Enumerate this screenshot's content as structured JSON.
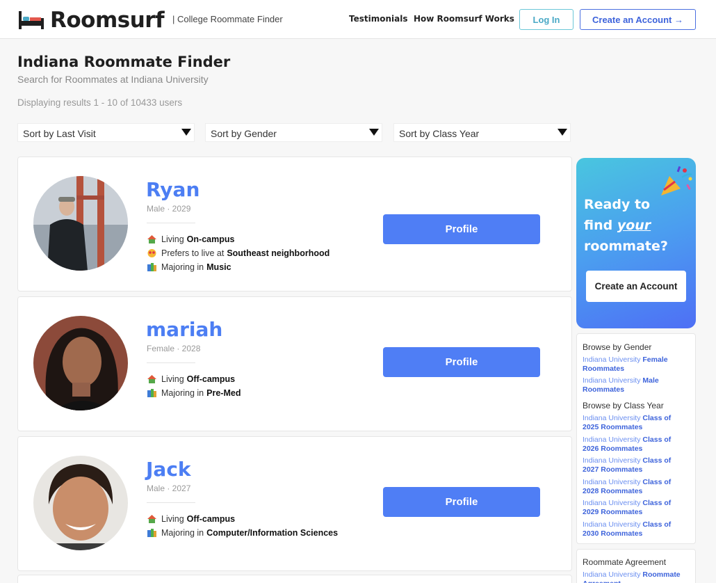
{
  "header": {
    "logo_text": "Roomsurf",
    "tagline": "| College Roommate Finder",
    "nav": [
      "Testimonials",
      "How Roomsurf Works"
    ],
    "login_label": "Log In",
    "create_label": "Create an Account →"
  },
  "page": {
    "title": "Indiana Roommate Finder",
    "subtitle": "Search for Roommates at Indiana University",
    "results_text": "Displaying results 1 - 10 of 10433 users"
  },
  "filters": [
    "Sort by Last Visit",
    "Sort by Gender",
    "Sort by Class Year"
  ],
  "profiles": [
    {
      "name": "Ryan",
      "meta": "Male · 2029",
      "details": [
        {
          "icon": "house-icon",
          "prefix": "Living",
          "value": "On-campus"
        },
        {
          "icon": "heart-eyes-icon",
          "prefix": "Prefers to live at",
          "value": "Southeast neighborhood"
        },
        {
          "icon": "books-icon",
          "prefix": "Majoring in",
          "value": "Music"
        }
      ],
      "button": "Profile"
    },
    {
      "name": "mariah",
      "meta": "Female · 2028",
      "details": [
        {
          "icon": "house-icon",
          "prefix": "Living",
          "value": "Off-campus"
        },
        {
          "icon": "books-icon",
          "prefix": "Majoring in",
          "value": "Pre-Med"
        }
      ],
      "button": "Profile"
    },
    {
      "name": "Jack",
      "meta": "Male · 2027",
      "details": [
        {
          "icon": "house-icon",
          "prefix": "Living",
          "value": "Off-campus"
        },
        {
          "icon": "books-icon",
          "prefix": "Majoring in",
          "value": "Computer/Information Sciences"
        }
      ],
      "button": "Profile"
    }
  ],
  "promo": {
    "line1": "Ready to",
    "line2_a": "find",
    "line2_b": "your",
    "line3": "roommate?",
    "button": "Create an Account"
  },
  "browse": {
    "gender_head": "Browse by Gender",
    "gender_links": [
      {
        "prefix": "Indiana University",
        "bold": "Female Roommates"
      },
      {
        "prefix": "Indiana University",
        "bold": "Male Roommates"
      }
    ],
    "year_head": "Browse by Class Year",
    "year_links": [
      {
        "prefix": "Indiana University",
        "bold": "Class of 2025 Roommates"
      },
      {
        "prefix": "Indiana University",
        "bold": "Class of 2026 Roommates"
      },
      {
        "prefix": "Indiana University",
        "bold": "Class of 2027 Roommates"
      },
      {
        "prefix": "Indiana University",
        "bold": "Class of 2028 Roommates"
      },
      {
        "prefix": "Indiana University",
        "bold": "Class of 2029 Roommates"
      },
      {
        "prefix": "Indiana University",
        "bold": "Class of 2030 Roommates"
      }
    ],
    "agreement_head": "Roommate Agreement",
    "agreement_link": {
      "prefix": "Indiana University",
      "bold": "Roommate Agreement"
    }
  },
  "colors": {
    "accent": "#4f7ef5",
    "name": "#4c7ef3",
    "login_border": "#6bc7d8"
  }
}
